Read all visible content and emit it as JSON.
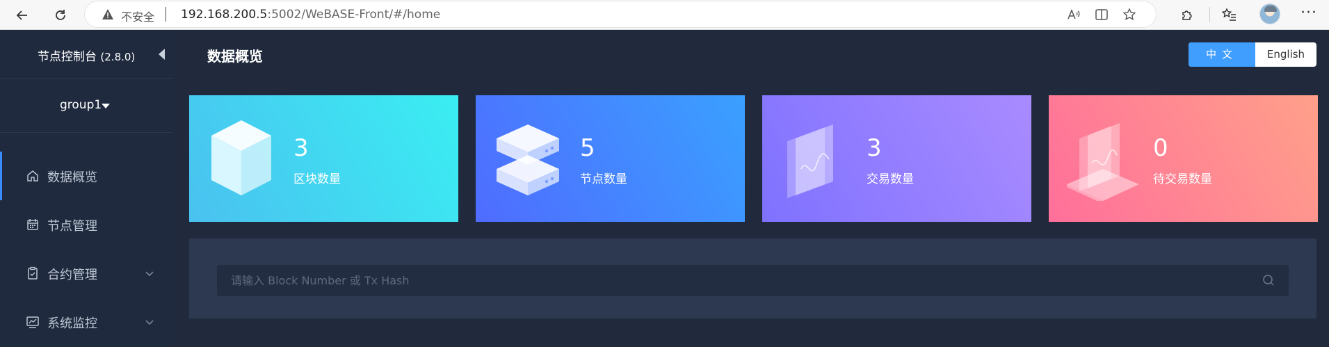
{
  "browser": {
    "insecure_label": "不安全",
    "url_host": "192.168.200.5",
    "url_rest": ":5002/WeBASE-Front/#/home"
  },
  "sidebar": {
    "title": "节点控制台",
    "version": "(2.8.0)",
    "group": "group1",
    "items": [
      {
        "label": "数据概览",
        "icon": "home-icon",
        "active": true
      },
      {
        "label": "节点管理",
        "icon": "calendar-icon"
      },
      {
        "label": "合约管理",
        "icon": "clipboard-icon",
        "expandable": true
      },
      {
        "label": "系统监控",
        "icon": "monitor-chart-icon",
        "expandable": true
      }
    ]
  },
  "main": {
    "title": "数据概览",
    "lang": {
      "zh": "中文",
      "en": "English",
      "selected": "zh"
    },
    "cards": [
      {
        "value": "3",
        "label": "区块数量",
        "icon": "cube-icon",
        "color_start": "#4ac1f0",
        "color_end": "#3aeef2"
      },
      {
        "value": "5",
        "label": "节点数量",
        "icon": "server-stack-icon",
        "color_start": "#4f6cff",
        "color_end": "#3aa0ff"
      },
      {
        "value": "3",
        "label": "交易数量",
        "icon": "transaction-chart-icon",
        "color_start": "#7f72ff",
        "color_end": "#a98bff"
      },
      {
        "value": "0",
        "label": "待交易数量",
        "icon": "pending-transaction-icon",
        "color_start": "#ff6f9a",
        "color_end": "#ffa08a"
      }
    ],
    "search": {
      "placeholder": "请输入 Block Number 或 Tx Hash",
      "value": ""
    }
  }
}
